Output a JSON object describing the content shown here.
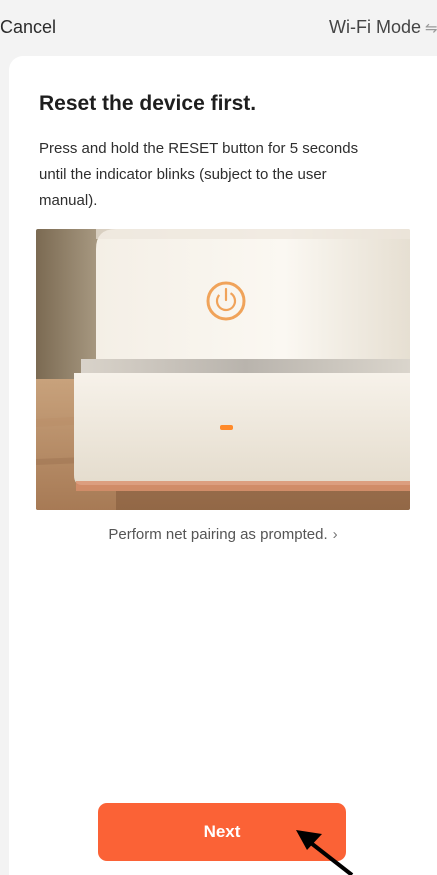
{
  "nav": {
    "cancel": "Cancel",
    "mode": "Wi-Fi Mode",
    "mode_icon": "switch-arrows-icon"
  },
  "content": {
    "title": "Reset the device first.",
    "description": "Press and hold the RESET button for 5 seconds until the indicator blinks (subject to the user manual).",
    "pairing_link": "Perform net pairing as prompted.",
    "pairing_chevron": "chevron-right-icon"
  },
  "actions": {
    "next": "Next"
  },
  "colors": {
    "accent": "#fb6236",
    "led": "#ff8a2a"
  }
}
